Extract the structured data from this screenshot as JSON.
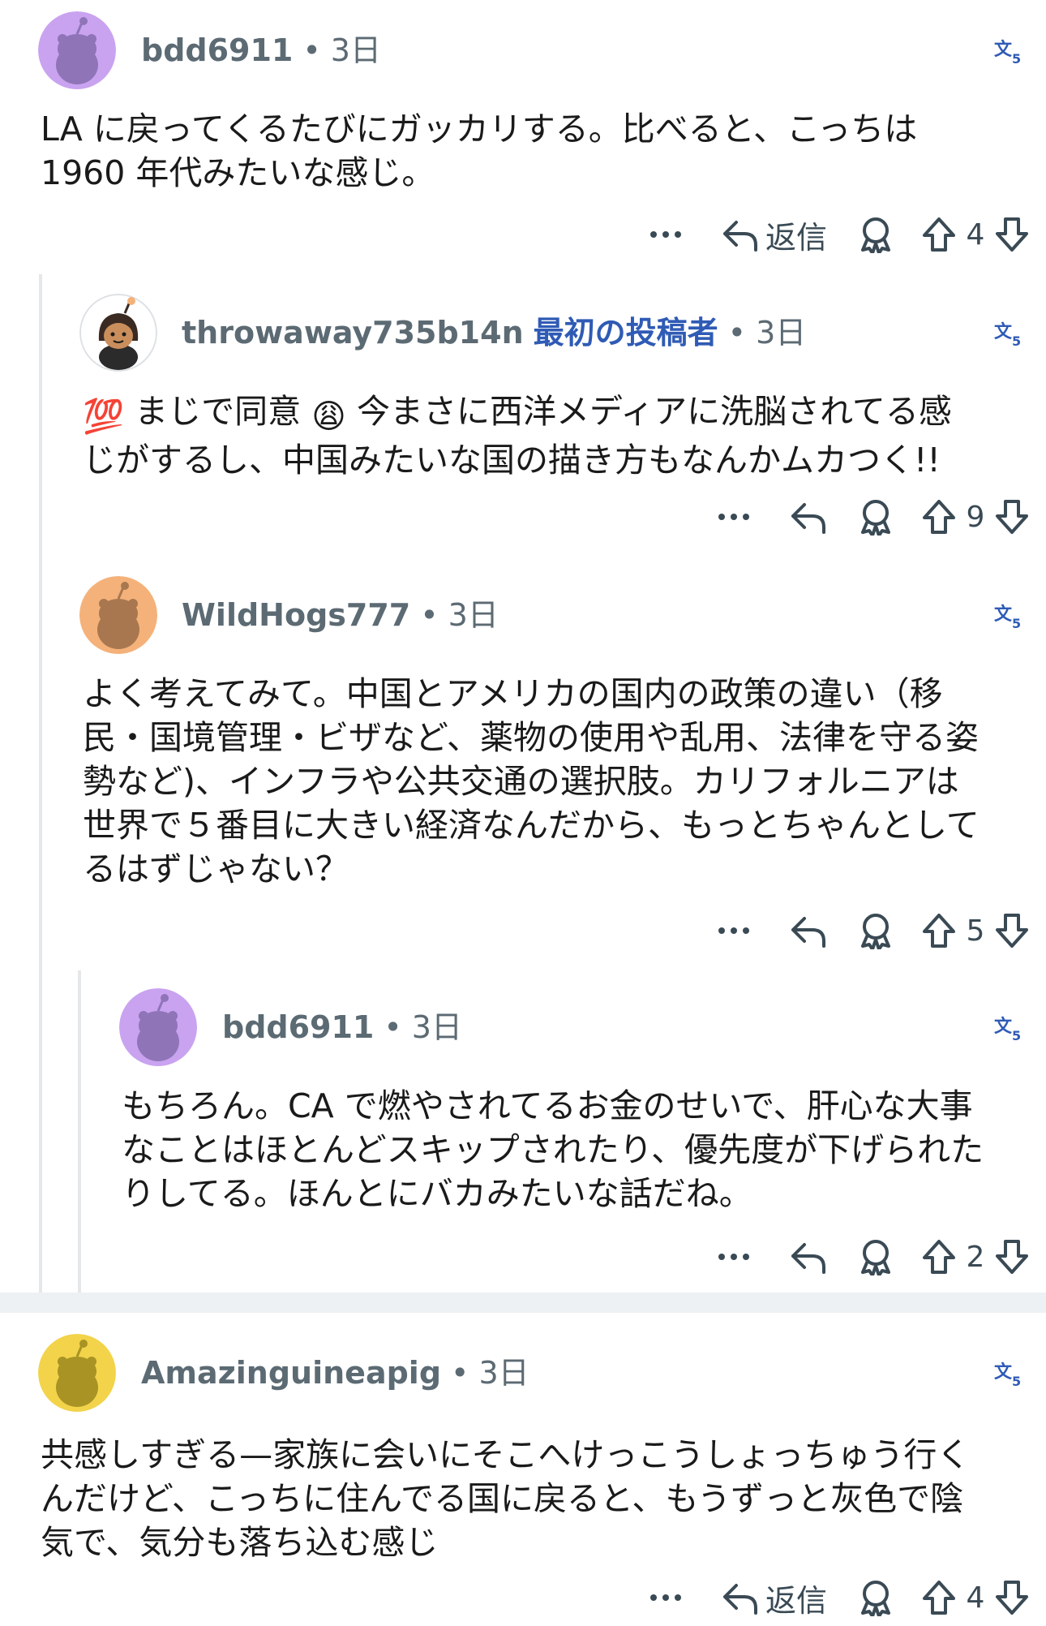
{
  "comments": [
    {
      "username": "bdd6911",
      "op_badge": "",
      "separator": "•",
      "time": "3日",
      "body_lines": [
        "LA に戻ってくるたびにガッカリする。比べると、こっちは",
        "1960 年代みたいな感じ。"
      ],
      "reply_label": "返信",
      "score": "4",
      "avatar_color": "#c9a3f0"
    },
    {
      "username": "throwaway735b14n",
      "op_badge": "最初の投稿者",
      "separator": "•",
      "time": "3日",
      "body_lines": [
        "まじで同意",
        "今まさに西洋メディアに洗脳されてる感",
        "じがするし、中国みたいな国の描き方もなんかムカつく!!"
      ],
      "emoji_1": "💯",
      "emoji_2": "😩",
      "reply_label": "",
      "score": "9",
      "avatar_color": "#ffffff"
    },
    {
      "username": "WildHogs777",
      "op_badge": "",
      "separator": "•",
      "time": "3日",
      "body_lines": [
        "よく考えてみて。中国とアメリカの国内の政策の違い（移",
        "民・国境管理・ビザなど、薬物の使用や乱用、法律を守る姿",
        "勢など)、インフラや公共交通の選択肢。カリフォルニアは",
        "世界で５番目に大きい経済なんだから、もっとちゃんとして",
        "るはずじゃない？"
      ],
      "reply_label": "",
      "score": "5",
      "avatar_color": "#f4b27a"
    },
    {
      "username": "bdd6911",
      "op_badge": "",
      "separator": "•",
      "time": "3日",
      "body_lines": [
        "もちろん。CA で燃やされてるお金のせいで、肝心な大事",
        "なことはほとんどスキップされたり、優先度が下げられた",
        "りしてる。ほんとにバカみたいな話だね。"
      ],
      "reply_label": "",
      "score": "2",
      "avatar_color": "#c9a3f0"
    },
    {
      "username": "Amazinguineapig",
      "op_badge": "",
      "separator": "•",
      "time": "3日",
      "body_lines": [
        "共感しすぎる—家族に会いにそこへけっこうしょっちゅう行く",
        "んだけど、こっちに住んでる国に戻ると、もうずっと灰色で陰",
        "気で、気分も落ち込む感じ"
      ],
      "reply_label": "返信",
      "score": "4",
      "avatar_color": "#f2d34a"
    }
  ],
  "colors": {
    "meta": "#5c6a73",
    "op": "#2f5bb5",
    "icon": "#3a4a55",
    "thread_line": "#e4e8eb",
    "separator_band": "#eef1f3"
  },
  "icons": [
    "more-icon",
    "reply-icon",
    "award-icon",
    "upvote-icon",
    "downvote-icon",
    "translate-icon",
    "snoo-avatar-icon"
  ]
}
